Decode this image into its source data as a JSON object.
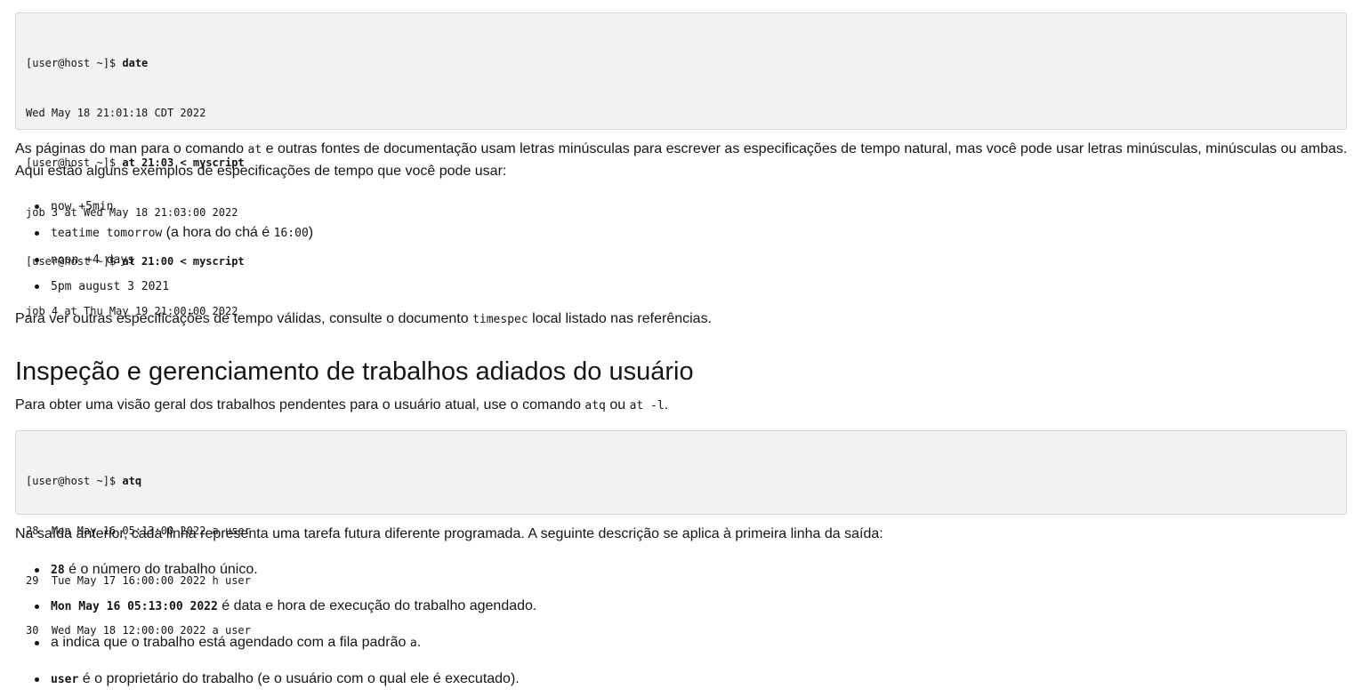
{
  "code_block_1": {
    "lines": [
      {
        "prompt": "[user@host ~]$ ",
        "command": "date",
        "output": ""
      },
      {
        "prompt": "",
        "command": "",
        "output": "Wed May 18 21:01:18 CDT 2022"
      },
      {
        "prompt": "[user@host ~]$ ",
        "command": "at 21:03 < myscript",
        "output": ""
      },
      {
        "prompt": "",
        "command": "",
        "output": "job 3 at Wed May 18 21:03:00 2022"
      },
      {
        "prompt": "[user@host ~]$ ",
        "command": "at 21:00 < myscript",
        "output": ""
      },
      {
        "prompt": "",
        "command": "",
        "output": "job 4 at Thu May 19 21:00:00 2022"
      }
    ]
  },
  "para_1": {
    "part1": "As páginas do man para o comando ",
    "code1": "at",
    "part2": " e outras fontes de documentação usam letras minúsculas para escrever as especificações de tempo natural, mas você pode usar letras minúsculas, minúsculas ou ambas.",
    "line2": "Aqui estão alguns exemplos de especificações de tempo que você pode usar:"
  },
  "time_examples": [
    {
      "code": "now +5min",
      "text": "",
      "code2": "",
      "text2": ""
    },
    {
      "code": "teatime tomorrow",
      "text": " (a hora do chá é ",
      "code2": "16:00",
      "text2": ")"
    },
    {
      "code": "noon +4 days",
      "text": "",
      "code2": "",
      "text2": ""
    },
    {
      "code": "5pm august 3 2021",
      "text": "",
      "code2": "",
      "text2": ""
    }
  ],
  "para_2": {
    "part1": "Para ver outras especificações de tempo válidas, consulte o documento ",
    "code1": "timespec",
    "part2": " local listado nas referências."
  },
  "heading": "Inspeção e gerenciamento de trabalhos adiados do usuário",
  "para_3": {
    "part1": "Para obter uma visão geral dos trabalhos pendentes para o usuário atual, use o comando ",
    "code1": "atq",
    "part2": " ou ",
    "code2": "at -l",
    "part3": "."
  },
  "code_block_2": {
    "lines": [
      {
        "prompt": "[user@host ~]$ ",
        "command": "atq",
        "output": ""
      },
      {
        "prompt": "",
        "command": "",
        "output": "28  Mon May 16 05:13:00 2022 a user"
      },
      {
        "prompt": "",
        "command": "",
        "output": "29  Tue May 17 16:00:00 2022 h user"
      },
      {
        "prompt": "",
        "command": "",
        "output": "30  Wed May 18 12:00:00 2022 a user"
      }
    ]
  },
  "para_4": "Na saída anterior, cada linha representa uma tarefa futura diferente programada. A seguinte descrição se aplica à primeira linha da saída:",
  "descriptions": [
    {
      "code": "28",
      "text": " é o número do trabalho único.",
      "code2": "",
      "text2": ""
    },
    {
      "code": "Mon May 16 05:13:00 2022",
      "text": " é data e hora de execução do trabalho agendado.",
      "code2": "",
      "text2": ""
    },
    {
      "code": "a",
      "text": " indica que o trabalho está agendado com a fila padrão ",
      "code2": "a",
      "text2": "."
    },
    {
      "code": "user",
      "text": " é o proprietário do trabalho (e o usuário com o qual ele é executado).",
      "code2": "",
      "text2": ""
    }
  ]
}
